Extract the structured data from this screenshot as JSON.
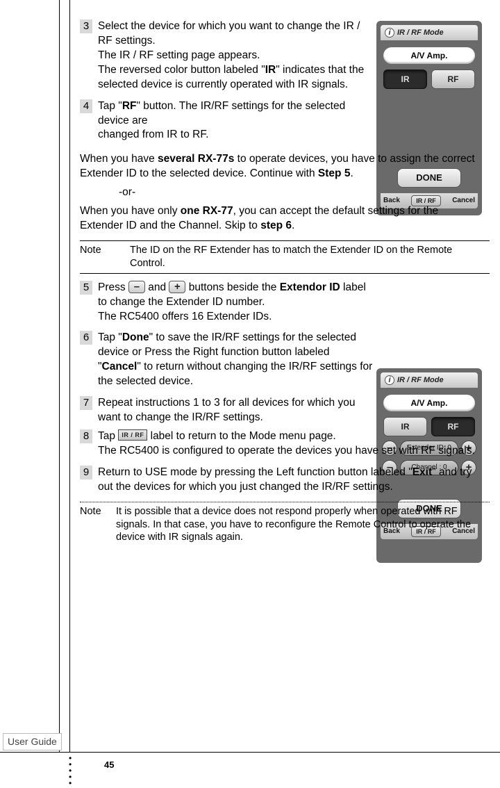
{
  "footer": {
    "user_guide": "User Guide",
    "page_number": "45"
  },
  "steps": {
    "s3": {
      "num": "3",
      "a": "Select the device for which you want to change the IR / RF settings.",
      "b": "The IR / RF setting page appears.",
      "c1": "The reversed color button labeled \"",
      "c_bold": "IR",
      "c2": "\" indicates that the selected device is currently operated with IR signals."
    },
    "s4": {
      "num": "4",
      "a1": "Tap \"",
      "a_bold": "RF",
      "a2": "\" button. The IR/RF settings for the selected device are",
      "b": "changed from IR to RF."
    },
    "s5": {
      "num": "5",
      "a1": "Press ",
      "a2": " and ",
      "a3": " buttons beside the ",
      "a_bold": "Extendor ID",
      "a4": " label to change the Extender ID number.",
      "b": "The RC5400 offers 16 Extender IDs."
    },
    "s6": {
      "num": "6",
      "a1": "Tap \"",
      "a_bold1": "Done",
      "a2": "\" to save the IR/RF settings for the selected device or Press the Right function button labeled \"",
      "a_bold2": "Cancel",
      "a3": "\" to return without changing the IR/RF settings for the selected device."
    },
    "s7": {
      "num": "7",
      "a": "Repeat instructions 1 to 3 for all devices for which you want to change the IR/RF settings."
    },
    "s8": {
      "num": "8",
      "a1": "Tap ",
      "a2": " label to return to the Mode menu page.",
      "b": "The RC5400 is configured to operate the devices you have set with RF signals."
    },
    "s9": {
      "num": "9",
      "a1": "Return to USE mode by pressing the Left function button labeled \"",
      "a_bold": "Exit",
      "a2": "\" and try out the devices for which you just changed the IR/RF settings."
    }
  },
  "mid": {
    "p1a": "When you have ",
    "p1b": "several RX-77s",
    "p1c": " to operate devices, you have to assign the correct Extender ID to the selected device. Continue with ",
    "p1d": "Step 5",
    "p1e": ".",
    "or": "-or-",
    "p2a": "When you have only ",
    "p2b": "one RX-77",
    "p2c": ", you can accept the default settings for the Extender ID and the Channel. Skip to ",
    "p2d": "step 6",
    "p2e": "."
  },
  "note1": {
    "label": "Note",
    "body": "The ID on the RF Extender has to match the Extender ID on the Remote Control."
  },
  "note2": {
    "label": "Note",
    "body": "It is possible that a device does not respond properly when operated with RF signals. In that case, you have to reconfigure the Remote Control to operate the device with IR signals again."
  },
  "icons": {
    "minus": "–",
    "plus": "+",
    "irrf": "IR / RF"
  },
  "shot": {
    "title": "IR / RF Mode",
    "device": "A/V Amp.",
    "ir": "IR",
    "rf": "RF",
    "ext": "Extender ID:  0",
    "chn": "Channel   :  0",
    "done": "DONE",
    "back": "Back",
    "mid": "IR / RF",
    "cancel": "Cancel"
  }
}
